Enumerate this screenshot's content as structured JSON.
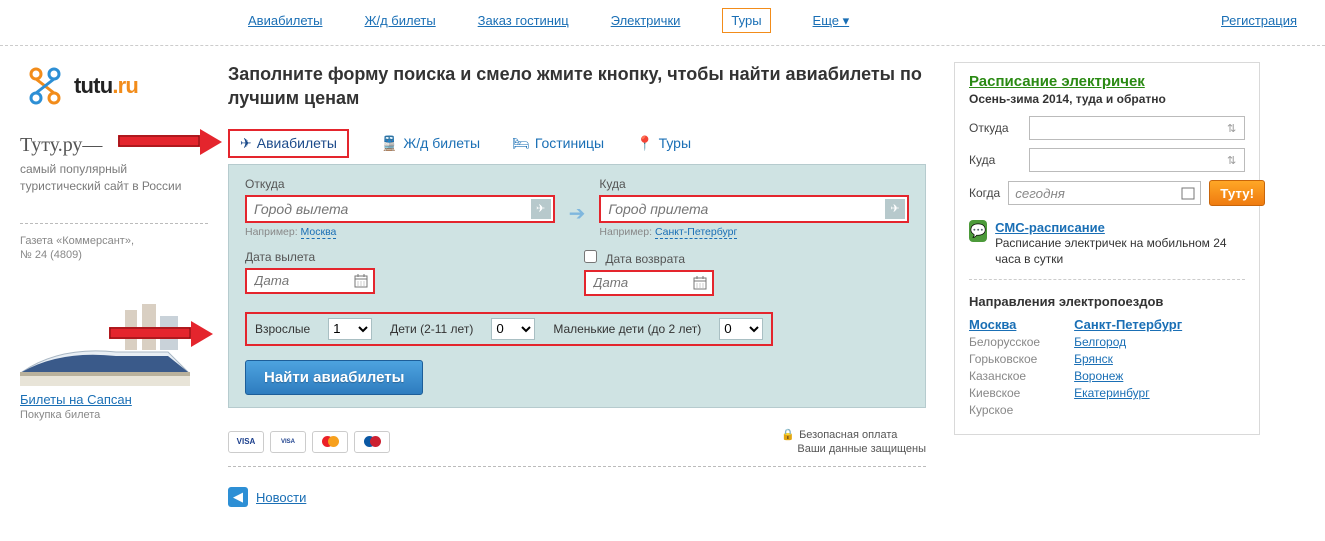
{
  "topnav": {
    "items": [
      "Авиабилеты",
      "Ж/д билеты",
      "Заказ гостиниц",
      "Электрички",
      "Туры"
    ],
    "more": "Еще",
    "register": "Регистрация",
    "active_index": 4
  },
  "logo": {
    "black": "tutu",
    "orange": ".ru"
  },
  "slogan": "Туту.ру—",
  "slogan_desc": "самый популярный туристический сайт в России",
  "paper": {
    "l1": "Газета «Коммерсант»,",
    "l2": "№ 24 (4809)"
  },
  "sapsan": {
    "link": "Билеты на Сапсан",
    "sub": "Покупка билета"
  },
  "headline": "Заполните форму поиска и смело жмите кнопку, чтобы найти авиабилеты по лучшим ценам",
  "tabs": [
    "Авиабилеты",
    "Ж/д билеты",
    "Гостиницы",
    "Туры"
  ],
  "search": {
    "from_lbl": "Откуда",
    "from_ph": "Город вылета",
    "from_hint_prefix": "Например: ",
    "from_hint": "Москва",
    "to_lbl": "Куда",
    "to_ph": "Город прилета",
    "to_hint_prefix": "Например: ",
    "to_hint": "Санкт-Петербург",
    "depart_lbl": "Дата вылета",
    "depart_ph": "Дата",
    "return_lbl": "Дата возврата",
    "return_ph": "Дата",
    "adults_lbl": "Взрослые",
    "adults_val": "1",
    "children_lbl": "Дети (2-11 лет)",
    "children_val": "0",
    "infants_lbl": "Маленькие дети (до 2 лет)",
    "infants_val": "0",
    "find": "Найти авиабилеты"
  },
  "secure": {
    "t": "Безопасная оплата",
    "d": "Ваши данные защищены"
  },
  "news": "Новости",
  "panel": {
    "title": "Расписание электричек",
    "sub": "Осень-зима 2014, туда и обратно",
    "from": "Откуда",
    "to": "Куда",
    "when": "Когда",
    "when_val": "сегодня",
    "btn": "Туту!"
  },
  "sms": {
    "title": "СМС-расписание",
    "desc": "Расписание электричек на мобильном 24 часа в сутки"
  },
  "dir": {
    "h": "Направления электропоездов",
    "col1": [
      {
        "t": "Москва",
        "big": true
      },
      {
        "t": "Белорусское",
        "sub": true
      },
      {
        "t": "Горьковское",
        "sub": true
      },
      {
        "t": "Казанское",
        "sub": true
      },
      {
        "t": "Киевское",
        "sub": true
      },
      {
        "t": "Курское",
        "sub": true
      }
    ],
    "col2": [
      {
        "t": "Санкт-Петербург",
        "big": true
      },
      {
        "t": "Белгород"
      },
      {
        "t": "Брянск"
      },
      {
        "t": "Воронеж"
      },
      {
        "t": "Екатеринбург"
      }
    ]
  },
  "cards": [
    "VISA",
    "VISA",
    "MC",
    "Maestro"
  ]
}
